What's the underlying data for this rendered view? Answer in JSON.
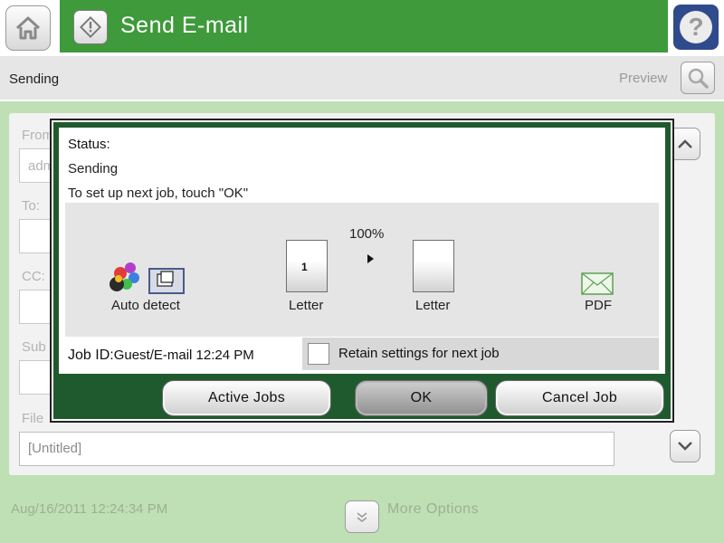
{
  "header": {
    "title": "Send E-mail",
    "help_label": "?"
  },
  "subheader": {
    "status": "Sending",
    "preview_label": "Preview"
  },
  "form": {
    "from_label": "From",
    "from_value": "adm",
    "to_label": "To:",
    "cc_label": "CC:",
    "subject_label": "Sub",
    "file_label": "File",
    "file_value": "[Untitled]"
  },
  "dialog": {
    "status_title": "Status:",
    "status_text": "Sending",
    "instruction": "To set up next job, touch \"OK\"",
    "color_mode": "Auto detect",
    "scale": "100%",
    "original_page_number": "1",
    "original_size": "Letter",
    "output_size": "Letter",
    "file_type": "PDF",
    "job_id_label": "Job ID:",
    "job_id_value": "Guest/E-mail 12:24 PM",
    "retain_label": "Retain settings for next job",
    "buttons": {
      "active_jobs": "Active Jobs",
      "ok": "OK",
      "cancel_job": "Cancel Job"
    }
  },
  "footer": {
    "timestamp": "Aug/16/2011 12:24:34 PM",
    "more_options": "More Options"
  },
  "colors": {
    "title_bar": "#3e9a3a",
    "help_button": "#304b8c",
    "dialog_frame": "#1f5a2e",
    "background": "#bfe0b4"
  }
}
